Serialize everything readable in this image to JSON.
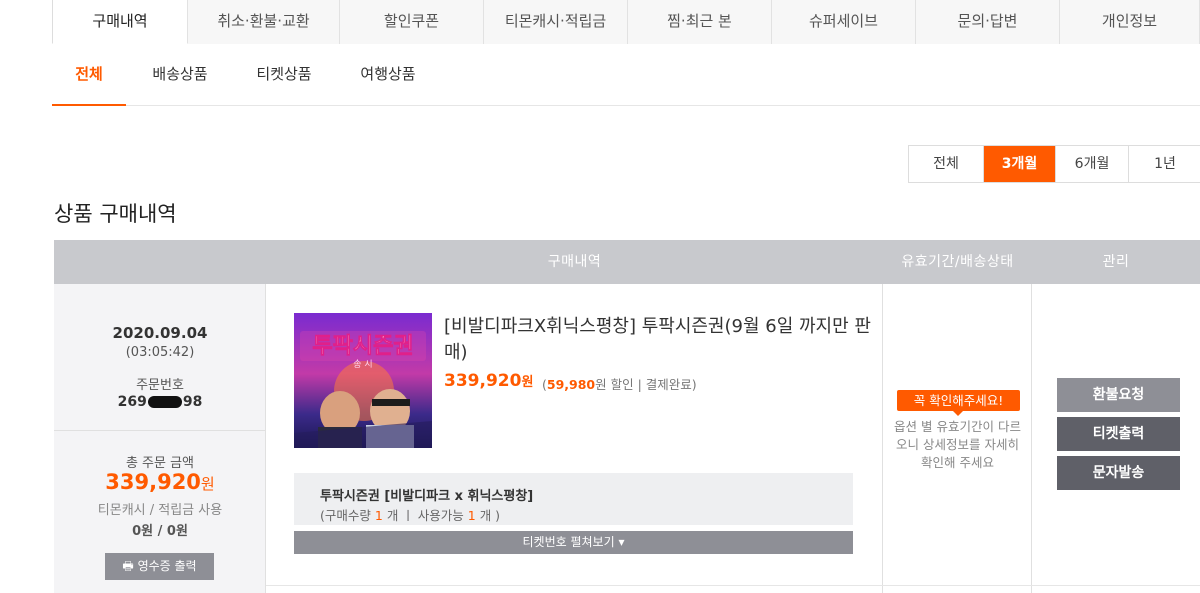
{
  "top_tabs": [
    "구매내역",
    "취소·환불·교환",
    "할인쿠폰",
    "티몬캐시·적립금",
    "찜·최근 본",
    "슈퍼세이브",
    "문의·답변",
    "개인정보"
  ],
  "sub_tabs": [
    "전체",
    "배송상품",
    "티켓상품",
    "여행상품"
  ],
  "period": [
    "전체",
    "3개월",
    "6개월",
    "1년"
  ],
  "section_title": "상품 구매내역",
  "table_head": {
    "purchase": "구매내역",
    "status": "유효기간/배송상태",
    "manage": "관리"
  },
  "order": {
    "date": "2020.09.04",
    "time": "(03:05:42)",
    "no_label": "주문번호",
    "no_prefix": "269",
    "no_suffix": "98",
    "total_label": "총 주문 금액",
    "total_amount": "339,920",
    "total_unit": "원",
    "cash_label": "티몬캐시 / 적립금 사용",
    "cash_value": "0원 / 0원",
    "receipt_button": "영수증 출력"
  },
  "product": {
    "thumb_title": "투팍시즌권",
    "thumb_sub": "송 시",
    "title": "[비발디파크X휘닉스평창] 투팍시즌권(9월 6일 까지만 판매)",
    "price": "339,920",
    "price_unit": "원",
    "discount_open": "(",
    "discount_amount": "59,980",
    "discount_text": "원 할인 | 결제완료)",
    "ticket_name": "투팍시즌권 [비발디파크 x 휘닉스평창]",
    "ticket_qty_label": "(구매수량",
    "ticket_qty": "1",
    "ticket_avail_label": "개   ㅣ  사용가능",
    "ticket_avail": "1",
    "ticket_avail_unit": "개 )",
    "toggle_label": "티켓번호 펼쳐보기 ▾"
  },
  "status": {
    "badge": "꼭 확인해주세요!",
    "note": "옵션 별 유효기간이 다르오니 상세정보를 자세히 확인해 주세요"
  },
  "manage": {
    "refund": "환불요청",
    "ticket": "티켓출력",
    "sms": "문자발송"
  },
  "colors": {
    "accent": "#ff5a00",
    "header_gray": "#c8c9cd",
    "button_gray": "#8e8f96",
    "button_dark": "#5f6068"
  }
}
